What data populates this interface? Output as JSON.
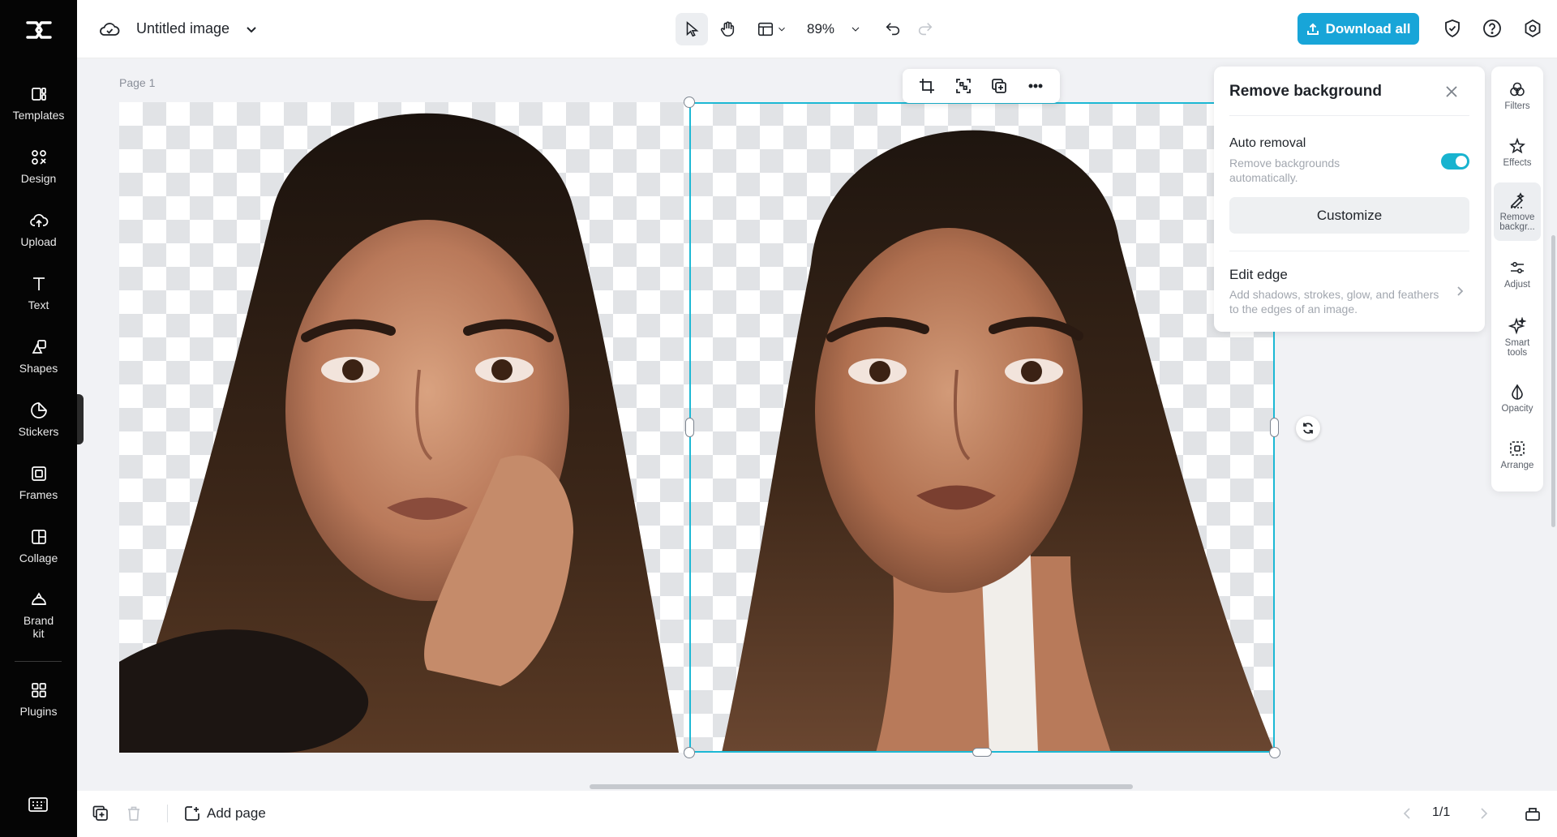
{
  "sidebar": {
    "items": [
      {
        "label": "Templates",
        "icon": "templates-icon"
      },
      {
        "label": "Design",
        "icon": "design-icon"
      },
      {
        "label": "Upload",
        "icon": "upload-cloud-icon"
      },
      {
        "label": "Text",
        "icon": "text-icon"
      },
      {
        "label": "Shapes",
        "icon": "shapes-icon"
      },
      {
        "label": "Stickers",
        "icon": "stickers-icon"
      },
      {
        "label": "Frames",
        "icon": "frames-icon"
      },
      {
        "label": "Collage",
        "icon": "collage-icon"
      },
      {
        "label": "Brand\nkit",
        "icon": "brand-kit-icon"
      },
      {
        "label": "Plugins",
        "icon": "plugins-icon"
      }
    ]
  },
  "header": {
    "title": "Untitled image",
    "zoom": "89%",
    "download_label": "Download all",
    "accent": "#18a5d8"
  },
  "canvas": {
    "page_label": "Page 1",
    "selection_color": "#1cb8d4"
  },
  "remove_bg_panel": {
    "title": "Remove background",
    "auto_removal_label": "Auto removal",
    "auto_removal_desc": "Remove backgrounds automatically.",
    "auto_removal_on": true,
    "customize_label": "Customize",
    "edit_edge_label": "Edit edge",
    "edit_edge_desc": "Add shadows, strokes, glow, and feathers to the edges of an image."
  },
  "rail": {
    "items": [
      {
        "label": "Filters"
      },
      {
        "label": "Effects"
      },
      {
        "label": "Remove backgr..."
      },
      {
        "label": "Adjust"
      },
      {
        "label": "Smart tools"
      },
      {
        "label": "Opacity"
      },
      {
        "label": "Arrange"
      }
    ]
  },
  "footer": {
    "add_page_label": "Add page",
    "pager": "1/1"
  }
}
